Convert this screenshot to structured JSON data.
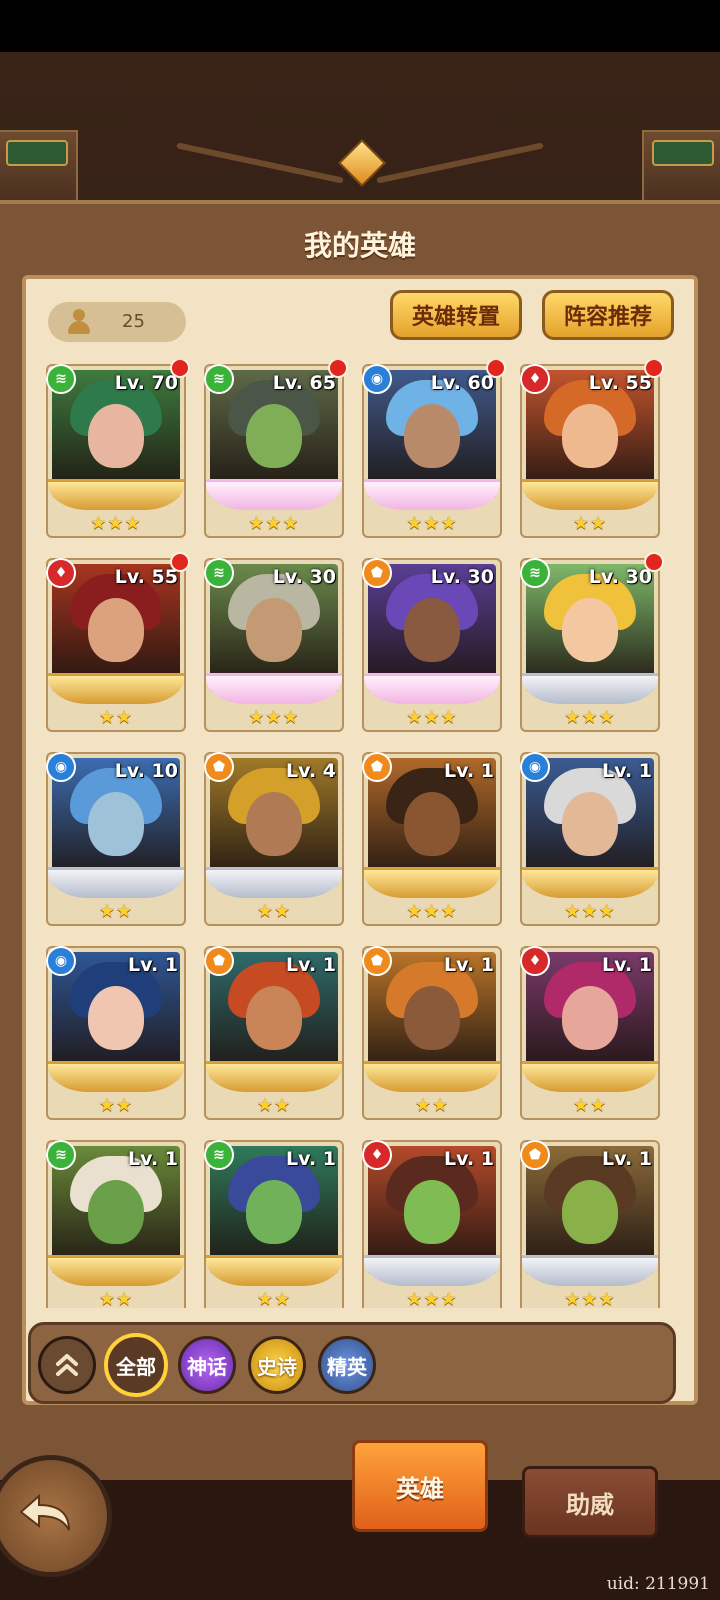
{
  "header": {
    "title": "我的英雄"
  },
  "hero_count": "25",
  "buttons": {
    "transfer": "英雄转置",
    "lineup": "阵容推荐"
  },
  "heroes": [
    {
      "level": "Lv. 70",
      "element": "wind",
      "stars": "★★★",
      "red_dot": true,
      "frame": "gold",
      "skin": "#e8b6a0",
      "hair": "#2f7a4a",
      "bg": "#3e7b3e"
    },
    {
      "level": "Lv. 65",
      "element": "wind",
      "stars": "★★★",
      "red_dot": true,
      "frame": "pink",
      "skin": "#7fae56",
      "hair": "#4a5648",
      "bg": "#5e6a48"
    },
    {
      "level": "Lv. 60",
      "element": "water",
      "stars": "★★★",
      "red_dot": true,
      "frame": "pink",
      "skin": "#b98a6a",
      "hair": "#6fb2e6",
      "bg": "#3f5a8c"
    },
    {
      "level": "Lv. 55",
      "element": "fire",
      "stars": "★★",
      "red_dot": true,
      "frame": "gold",
      "skin": "#efb990",
      "hair": "#d56a28",
      "bg": "#c2542e"
    },
    {
      "level": "Lv. 55",
      "element": "fire",
      "stars": "★★",
      "red_dot": true,
      "frame": "gold",
      "skin": "#dca27e",
      "hair": "#8a1e1e",
      "bg": "#a8361f"
    },
    {
      "level": "Lv. 30",
      "element": "wind",
      "stars": "★★★",
      "red_dot": false,
      "frame": "pink",
      "skin": "#c49a74",
      "hair": "#b9b6a2",
      "bg": "#6b8a4c"
    },
    {
      "level": "Lv. 30",
      "element": "light",
      "stars": "★★★",
      "red_dot": false,
      "frame": "pink",
      "skin": "#8a5a40",
      "hair": "#6a48b8",
      "bg": "#5a3f94"
    },
    {
      "level": "Lv. 30",
      "element": "wind",
      "stars": "★★★",
      "red_dot": true,
      "frame": "silver",
      "skin": "#f3c7a0",
      "hair": "#f0c13a",
      "bg": "#7fb86a"
    },
    {
      "level": "Lv. 10",
      "element": "water",
      "stars": "★★",
      "red_dot": false,
      "frame": "silver",
      "skin": "#9ec2d8",
      "hair": "#5a9ad8",
      "bg": "#3c6cb0"
    },
    {
      "level": "Lv. 4",
      "element": "light",
      "stars": "★★",
      "red_dot": false,
      "frame": "silver",
      "skin": "#b07a55",
      "hair": "#d4a02a",
      "bg": "#a07a2a"
    },
    {
      "level": "Lv. 1",
      "element": "light",
      "stars": "★★★",
      "red_dot": false,
      "frame": "gold",
      "skin": "#8a5632",
      "hair": "#3a2416",
      "bg": "#b06a2a"
    },
    {
      "level": "Lv. 1",
      "element": "water",
      "stars": "★★★",
      "red_dot": false,
      "frame": "gold",
      "skin": "#e3b896",
      "hair": "#d9d9d9",
      "bg": "#3a5c94"
    },
    {
      "level": "Lv. 1",
      "element": "water",
      "stars": "★★",
      "red_dot": false,
      "frame": "gold",
      "skin": "#f0c6b0",
      "hair": "#1f3e7a",
      "bg": "#2f5694"
    },
    {
      "level": "Lv. 1",
      "element": "light",
      "stars": "★★",
      "red_dot": false,
      "frame": "gold",
      "skin": "#c98458",
      "hair": "#c64a22",
      "bg": "#2f6a6a"
    },
    {
      "level": "Lv. 1",
      "element": "light",
      "stars": "★★",
      "red_dot": false,
      "frame": "gold",
      "skin": "#8a5a3a",
      "hair": "#d47a2a",
      "bg": "#b8742a"
    },
    {
      "level": "Lv. 1",
      "element": "fire",
      "stars": "★★",
      "red_dot": false,
      "frame": "gold",
      "skin": "#e6a79a",
      "hair": "#b02a6a",
      "bg": "#7a3a6a"
    },
    {
      "level": "Lv. 1",
      "element": "wind",
      "stars": "★★",
      "red_dot": false,
      "frame": "gold",
      "skin": "#6aa04a",
      "hair": "#e9e0cf",
      "bg": "#6a8a3a"
    },
    {
      "level": "Lv. 1",
      "element": "wind",
      "stars": "★★",
      "red_dot": false,
      "frame": "gold",
      "skin": "#6fb25a",
      "hair": "#3a4a9a",
      "bg": "#2f7a5a"
    },
    {
      "level": "Lv. 1",
      "element": "fire",
      "stars": "★★★",
      "red_dot": false,
      "frame": "silver",
      "skin": "#7fbd54",
      "hair": "#5a2a1e",
      "bg": "#b44a2a"
    },
    {
      "level": "Lv. 1",
      "element": "light",
      "stars": "★★★",
      "red_dot": false,
      "frame": "silver",
      "skin": "#8ab04a",
      "hair": "#5a3a22",
      "bg": "#8a6a3a"
    }
  ],
  "filters": {
    "all": "全部",
    "myth": "神话",
    "epic": "史诗",
    "elite": "精英"
  },
  "tabs": {
    "heroes": "英雄",
    "support": "助威"
  },
  "uid": "uid: 211991",
  "colors": {
    "wind": "#3bb33a",
    "water": "#2a7fd8",
    "fire": "#d8292a",
    "light": "#f08a1a"
  }
}
